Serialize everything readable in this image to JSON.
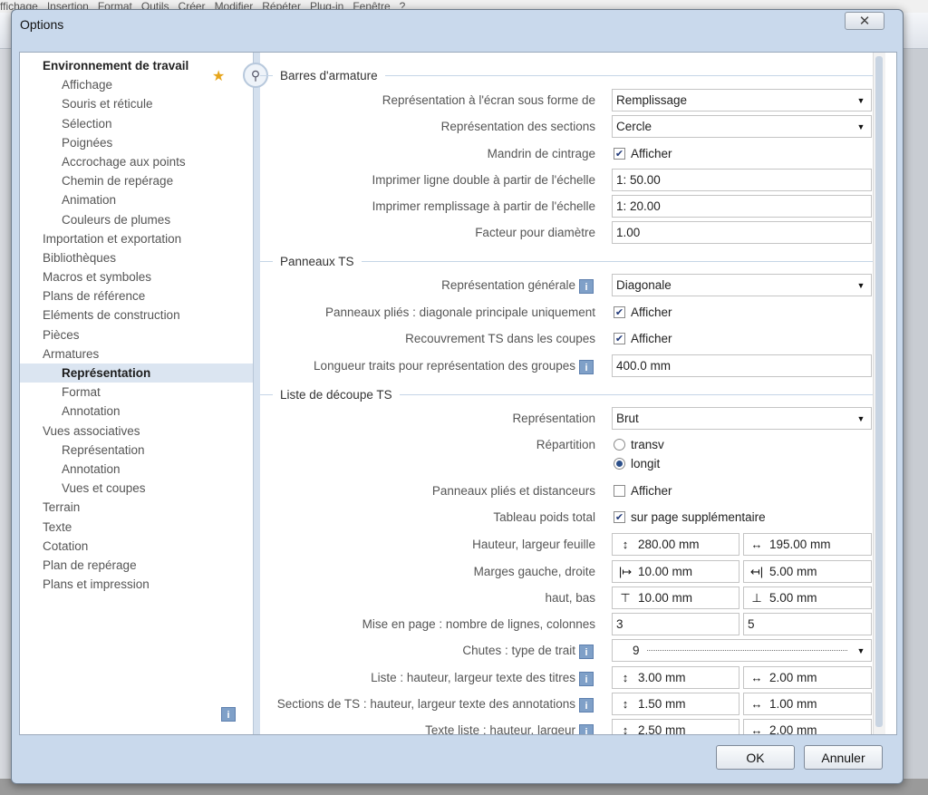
{
  "dialog": {
    "title": "Options",
    "close_label": "✕",
    "ok_label": "OK",
    "cancel_label": "Annuler"
  },
  "background_menu": [
    "ffichage",
    "Insertion",
    "Format",
    "Outils",
    "Créer",
    "Modifier",
    "Répéter",
    "Plug-in",
    "Fenêtre",
    "?"
  ],
  "nav": {
    "items": [
      {
        "label": "Environnement de travail"
      },
      {
        "label": "Affichage"
      },
      {
        "label": "Souris et réticule"
      },
      {
        "label": "Sélection"
      },
      {
        "label": "Poignées"
      },
      {
        "label": "Accrochage aux points"
      },
      {
        "label": "Chemin de repérage"
      },
      {
        "label": "Animation"
      },
      {
        "label": "Couleurs de plumes"
      },
      {
        "label": "Importation et exportation"
      },
      {
        "label": "Bibliothèques"
      },
      {
        "label": "Macros et symboles"
      },
      {
        "label": "Plans de référence"
      },
      {
        "label": "Eléments de construction"
      },
      {
        "label": "Pièces"
      },
      {
        "label": "Armatures"
      },
      {
        "label": "Représentation"
      },
      {
        "label": "Format"
      },
      {
        "label": "Annotation"
      },
      {
        "label": "Vues associatives"
      },
      {
        "label": "Représentation"
      },
      {
        "label": "Annotation"
      },
      {
        "label": "Vues et coupes"
      },
      {
        "label": "Terrain"
      },
      {
        "label": "Texte"
      },
      {
        "label": "Cotation"
      },
      {
        "label": "Plan de repérage"
      },
      {
        "label": "Plans et impression"
      }
    ],
    "info_label": "i"
  },
  "sections": {
    "barres": {
      "title": "Barres d'armature",
      "rep_ecran_label": "Représentation à l'écran sous forme de",
      "rep_ecran_value": "Remplissage",
      "rep_sections_label": "Représentation des sections",
      "rep_sections_value": "Cercle",
      "mandrin_label": "Mandrin de cintrage",
      "mandrin_value": "Afficher",
      "ligne_double_label": "Imprimer ligne double à partir de l'échelle",
      "ligne_double_value": "1: 50.00",
      "remplissage_label": "Imprimer remplissage à partir de l'échelle",
      "remplissage_value": "1: 20.00",
      "facteur_label": "Facteur pour diamètre",
      "facteur_value": "1.00"
    },
    "panneaux": {
      "title": "Panneaux TS",
      "rep_generale_label": "Représentation générale",
      "rep_generale_value": "Diagonale",
      "plies_label": "Panneaux pliés : diagonale principale uniquement",
      "plies_value": "Afficher",
      "recouvrement_label": "Recouvrement TS dans les coupes",
      "recouvrement_value": "Afficher",
      "longueur_label": "Longueur traits pour représentation des groupes",
      "longueur_value": "400.0 mm"
    },
    "liste": {
      "title": "Liste de découpe TS",
      "representation_label": "Représentation",
      "representation_value": "Brut",
      "repartition_label": "Répartition",
      "radio_transv": "transv",
      "radio_longit": "longit",
      "distanceurs_label": "Panneaux pliés et distanceurs",
      "distanceurs_value": "Afficher",
      "tableau_label": "Tableau poids total",
      "tableau_value": "sur page supplémentaire",
      "feuille_label": "Hauteur, largeur feuille",
      "feuille_h": "280.00 mm",
      "feuille_w": "195.00 mm",
      "marges_gd_label": "Marges gauche, droite",
      "marge_g": "10.00 mm",
      "marge_d": "5.00 mm",
      "marges_hb_label": "haut, bas",
      "marge_h": "10.00 mm",
      "marge_b": "5.00 mm",
      "mise_en_page_label": "Mise en page : nombre de lignes, colonnes",
      "lignes": "3",
      "colonnes": "5",
      "chutes_label": "Chutes : type de trait",
      "chutes_value": "9",
      "titres_label": "Liste : hauteur, largeur texte des titres",
      "titres_h": "3.00 mm",
      "titres_w": "2.00 mm",
      "annotations_label": "Sections de TS : hauteur, largeur texte des annotations",
      "annotations_h": "1.50 mm",
      "annotations_w": "1.00 mm",
      "texte_liste_label": "Texte liste : hauteur, largeur",
      "texte_liste_h": "2.50 mm",
      "texte_liste_w": "2.00 mm"
    }
  },
  "icons": {
    "info": "i",
    "check": "✔",
    "dropdown": "▼",
    "height": "↕",
    "width": "↔",
    "margin_left": "|↦",
    "margin_right": "↤|",
    "margin_top": "⊤",
    "margin_bottom": "⊥",
    "search": "⚲",
    "favorite": "★"
  }
}
